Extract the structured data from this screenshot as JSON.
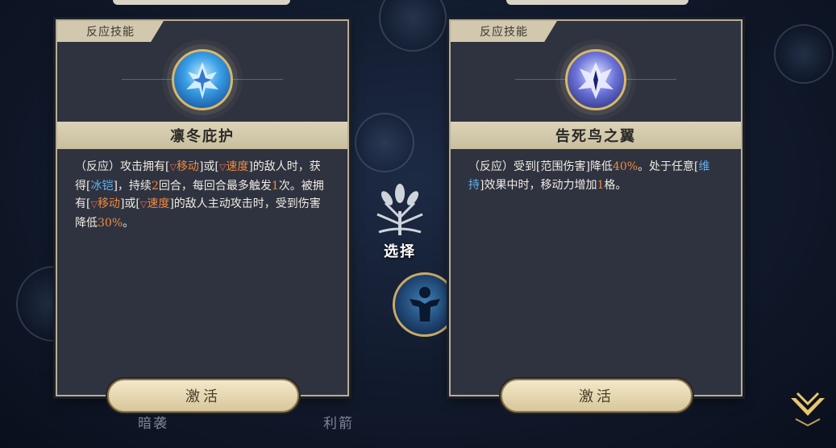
{
  "left_card": {
    "tag": "反应技能",
    "title": "凛冬庇护",
    "description": {
      "p1": "（反应）攻击拥有[",
      "kw_move_1": "移动",
      "p2": "]或[",
      "kw_speed_1": "速度",
      "p3": "]的敌人时，获得[",
      "kw_ice": "冰铠",
      "p4": "]，持续",
      "num_turns": "2",
      "p5": "回合，每回合最多触发",
      "num_times": "1",
      "p6": "次。被拥有[",
      "kw_move_2": "移动",
      "p7": "]或[",
      "kw_speed_2": "速度",
      "p8": "]的敌人主动攻击时，受到伤害降低",
      "num_pct": "30%",
      "p9": "。"
    },
    "button": "激活",
    "icon": "ice-crystal-icon"
  },
  "right_card": {
    "tag": "反应技能",
    "title": "告死鸟之翼",
    "description": {
      "p1": "（反应）受到[范围伤害]降低",
      "num_pct": "40%",
      "p2": "。处于任意[",
      "kw_maintain": "维持",
      "p3": "]效果中时，移动力增加",
      "num_cells": "1",
      "p4": "格。"
    },
    "button": "激活",
    "icon": "wing-bird-icon"
  },
  "center": {
    "choose_label": "选择",
    "icon": "tree-emblem-icon"
  },
  "background": {
    "tab_left": "暗袭",
    "tab_right": "利箭"
  },
  "colors": {
    "keyword_orange": "#f08a3d",
    "keyword_blue": "#5fb0ea",
    "button_gold": "#d8c79b"
  }
}
